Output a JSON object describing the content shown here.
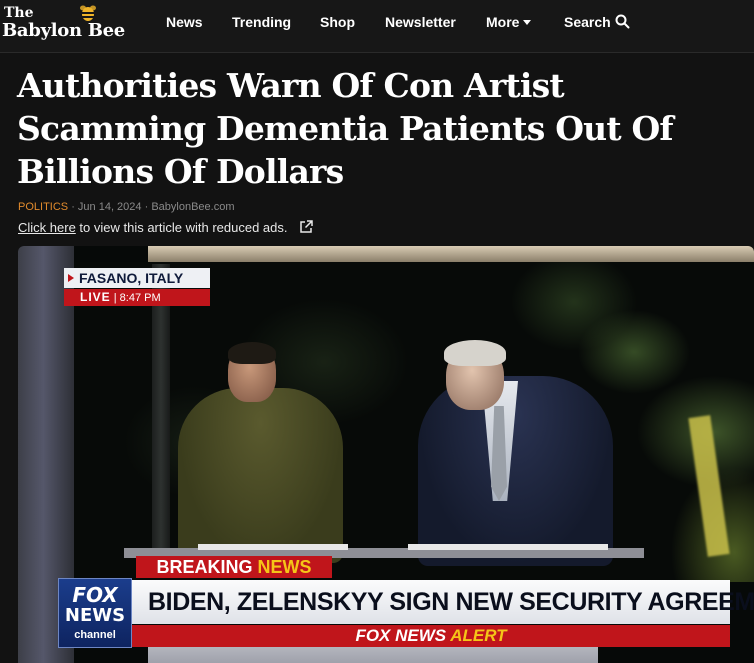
{
  "nav": {
    "logo_the": "The",
    "logo_name": "Babylon Bee",
    "items": [
      "News",
      "Trending",
      "Shop",
      "Newsletter"
    ],
    "more_label": "More",
    "search_label": "Search"
  },
  "article": {
    "title": "Authorities Warn Of Con Artist Scamming Dementia Patients Out Of Billions Of Dollars",
    "category": "POLITICS",
    "separator1": "·",
    "date": "Jun 14, 2024",
    "separator2": "·",
    "source": "BabylonBee.com",
    "reduced_link": "Click here",
    "reduced_text": " to view this article with reduced ads."
  },
  "broadcast": {
    "location": "FASANO, ITALY",
    "live": "LIVE",
    "live_divider": "|",
    "time": "8:47 PM",
    "breaking_word1": "BREAKING",
    "breaking_word2": "NEWS",
    "network_line1": "FOX",
    "network_line2": "NEWS",
    "network_line3": "channel",
    "headline": "BIDEN, ZELENSKYY SIGN NEW SECURITY AGREEMENT",
    "alert_word1": "FOX NEWS",
    "alert_word2": "ALERT"
  },
  "colors": {
    "category": "#e08a2c",
    "fox_red": "#c0151b",
    "fox_yellow": "#f5c518",
    "fox_blue": "#1b3d8c"
  }
}
